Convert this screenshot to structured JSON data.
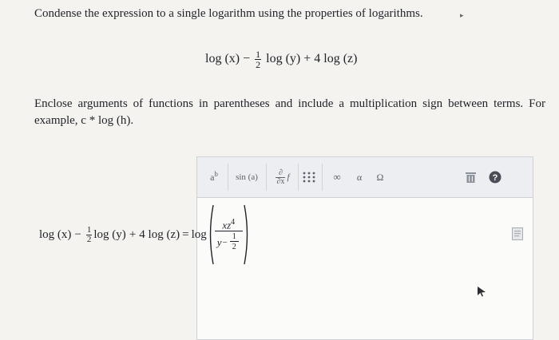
{
  "prompt": "Condense the expression to a single logarithm using the properties of logarithms.",
  "expression": {
    "term1": "log (x)",
    "minus": "−",
    "half_num": "1",
    "half_den": "2",
    "term2": "log (y)",
    "plus": "+",
    "term3": "4 log (z)"
  },
  "instructions": "Enclose arguments of functions in parentheses and include a multiplication sign between terms. For example, c * log (h).",
  "toolbar": {
    "power": {
      "base": "a",
      "exp": "b"
    },
    "sin": "sin (a)",
    "deriv": {
      "num": "∂",
      "den": "∂x",
      "f": "f"
    },
    "infinity": "∞",
    "alpha": "α",
    "omega": "Ω"
  },
  "answer": {
    "lhs_term1": "log (x)",
    "minus": "−",
    "half_num": "1",
    "half_den": "2",
    "lhs_term2": "log (y)",
    "plus": "+",
    "lhs_term3": "4 log (z)",
    "equals": "=",
    "log": "log",
    "numerator_base": "xz",
    "numerator_exp": "4",
    "denominator_base": "y",
    "denominator_exp_num": "1",
    "denominator_exp_den": "2"
  },
  "colors": {
    "help_button": "#4a4d55",
    "toolbar_bg": "#eceef1"
  }
}
